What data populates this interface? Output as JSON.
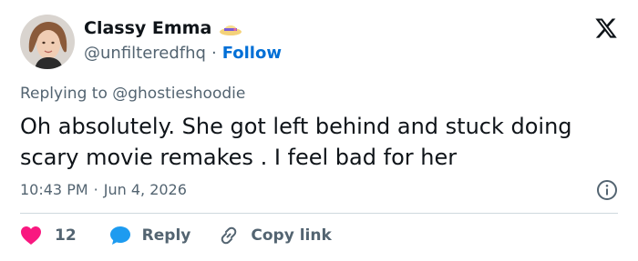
{
  "author": {
    "name": "Classy Emma",
    "handle": "@unfilteredfhq",
    "separator": "·",
    "follow_label": "Follow"
  },
  "replying_to": "Replying to @ghostieshoodie",
  "tweet": {
    "text": "Oh absolutely. She got left behind and stuck doing scary movie remakes . I feel bad for her"
  },
  "meta": {
    "time": "10:43 PM",
    "separator": "·",
    "date": "Jun 4, 2026"
  },
  "actions": {
    "like_count": "12",
    "reply_label": "Reply",
    "copy_label": "Copy link"
  },
  "icons": {
    "platform": "x-logo-icon",
    "hat": "sun-hat-emoji-icon",
    "info": "info-icon",
    "like": "heart-icon",
    "reply": "speech-bubble-icon",
    "copy": "link-icon"
  },
  "colors": {
    "like": "#f91880",
    "reply": "#1d9bf0",
    "follow": "#006fd6",
    "secondary_text": "#536471"
  }
}
